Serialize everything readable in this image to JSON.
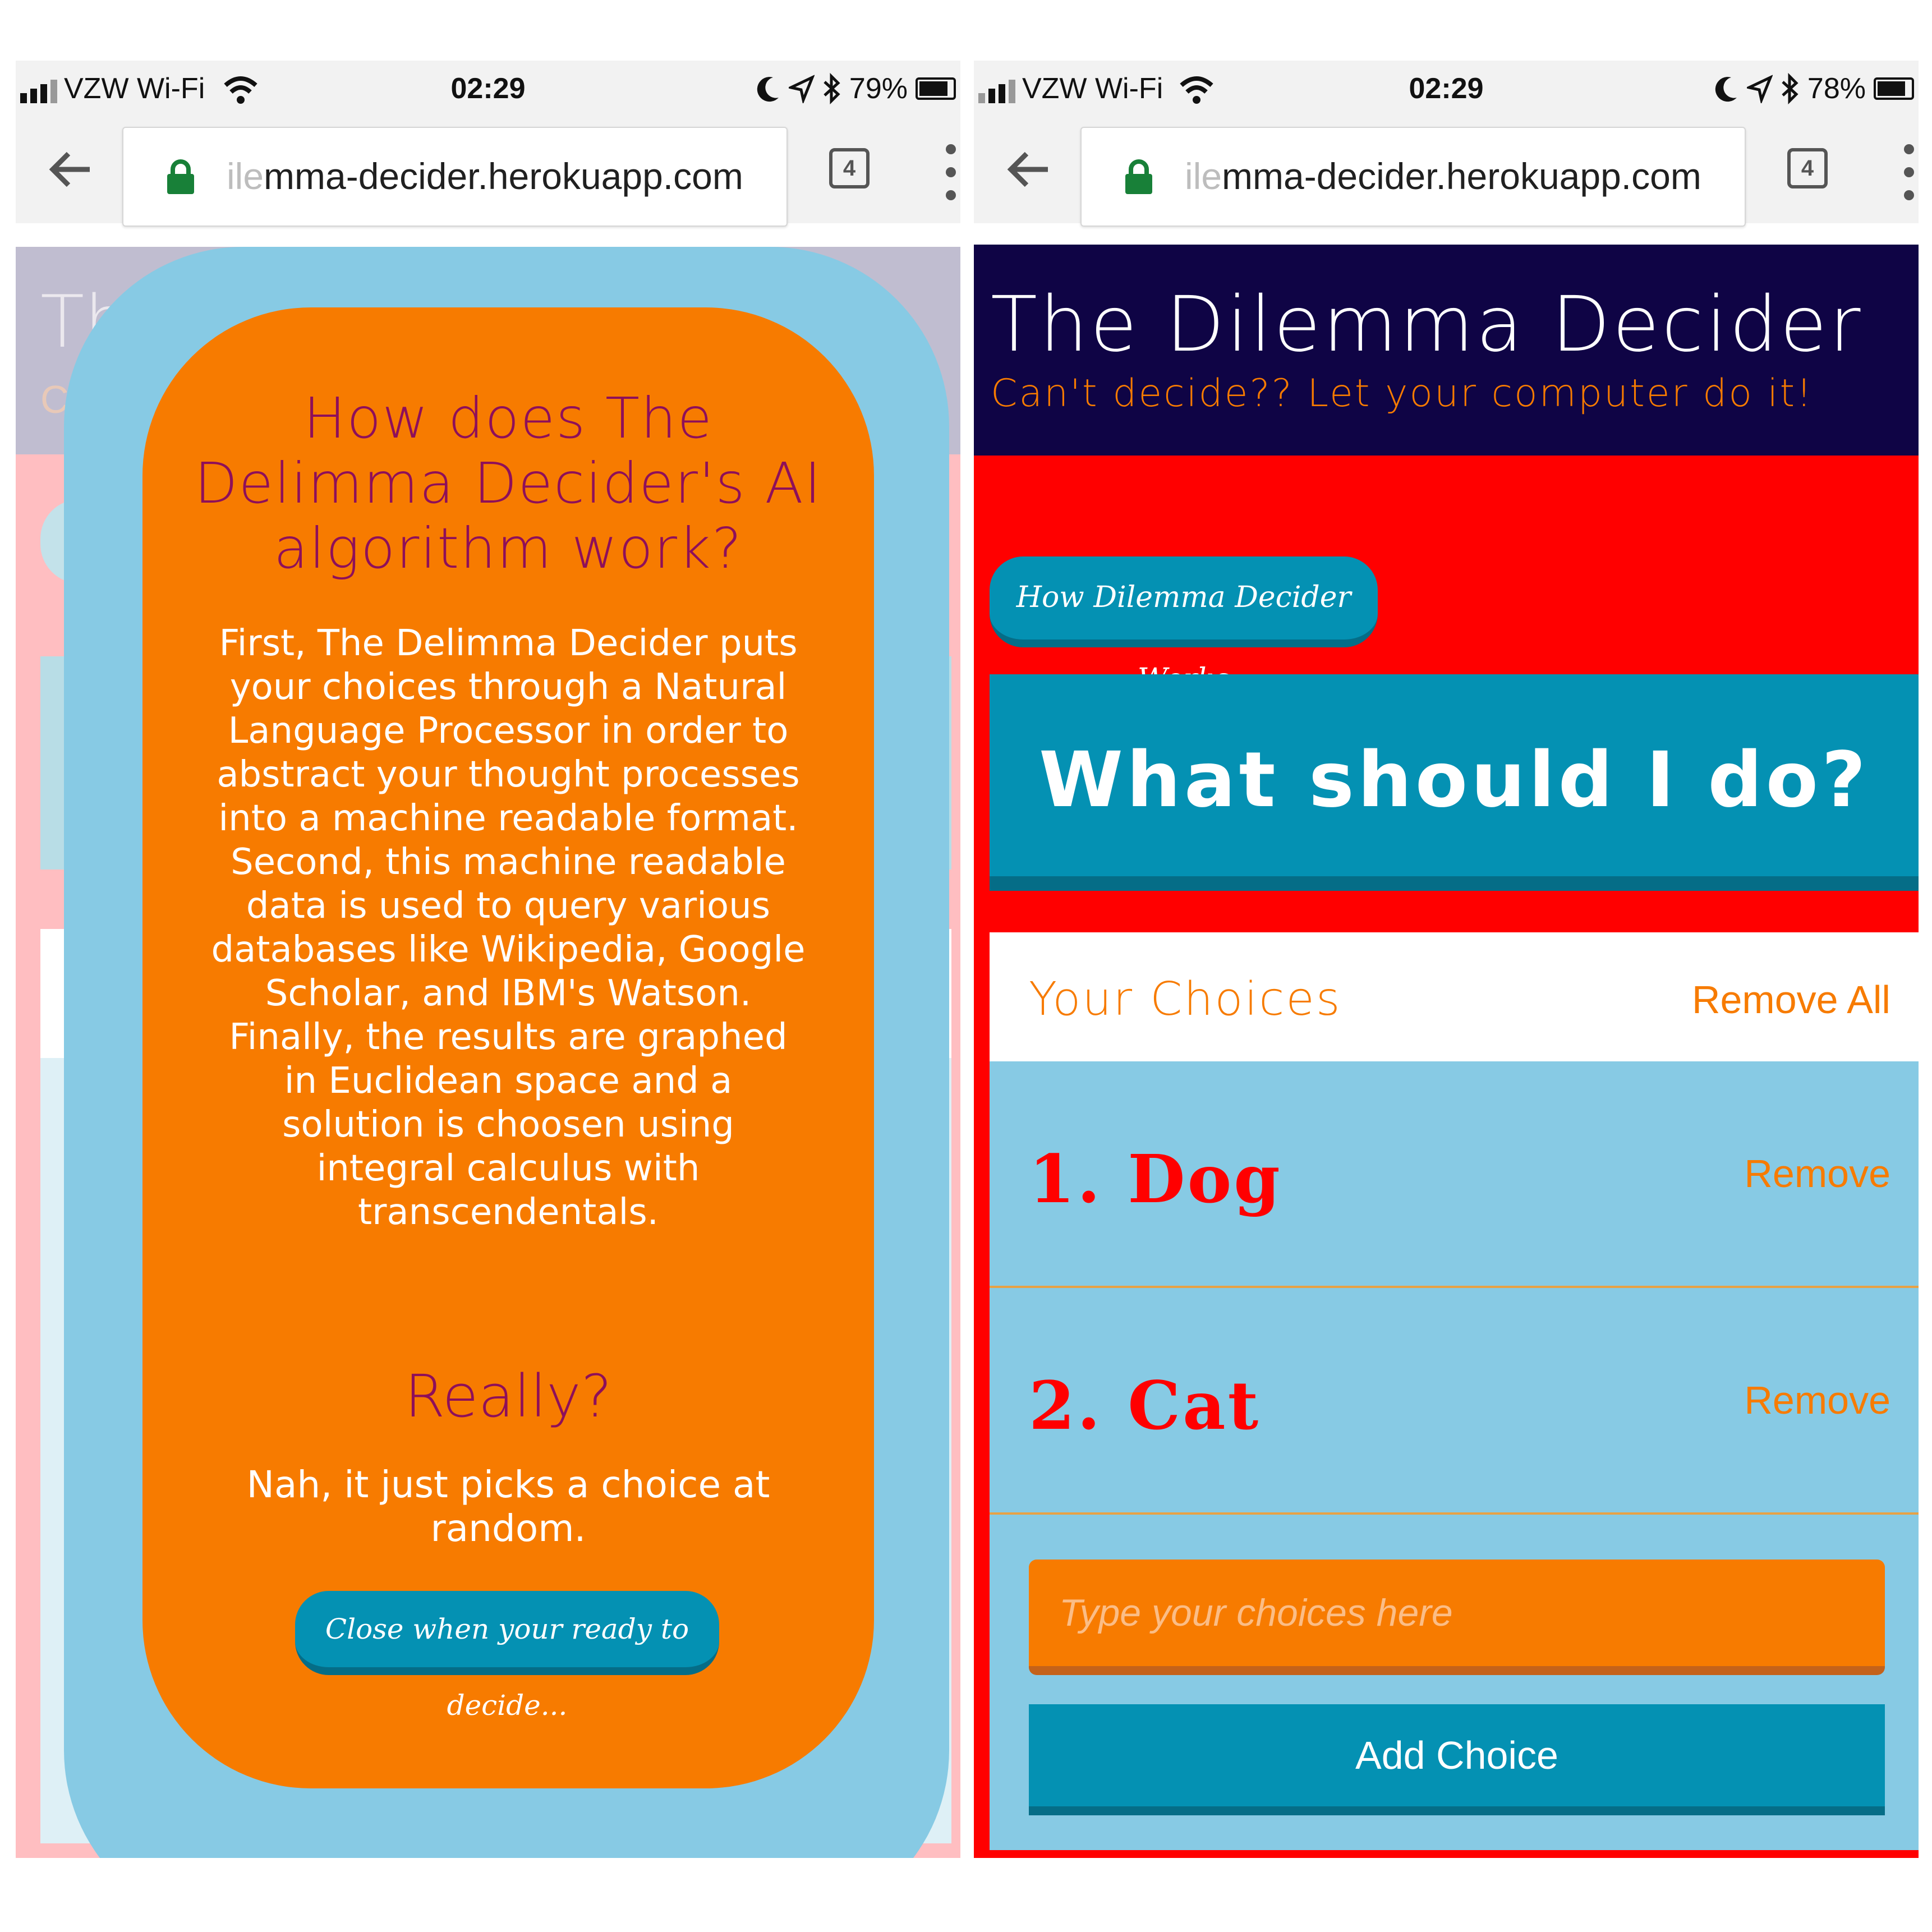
{
  "left_screen": {
    "status": {
      "carrier": "VZW Wi-Fi",
      "time": "02:29",
      "battery": "79%",
      "battery_level": 0.79
    },
    "browser": {
      "url_faded": "ile",
      "url_main": "mma-decider.herokuapp.com",
      "tab_count": "4"
    },
    "background": {
      "title_fragment": "Th",
      "subtitle_fragment": "C"
    },
    "modal": {
      "title": "How does The Delimma Decider's AI algorithm work?",
      "explanation": "First, The Delimma Decider puts your choices through a Natural Language Processor in order to abstract your thought processes into a machine readable format. Second, this machine readable data is used to query various databases like Wikipedia, Google Scholar, and IBM's Watson. Finally, the results are graphed in Euclidean space and a solution is choosen using integral calculus with transcendentals.",
      "question": "Really?",
      "answer": "Nah, it just picks a choice at random.",
      "close_label": "Close when your ready to decide..."
    }
  },
  "right_screen": {
    "status": {
      "carrier": "VZW Wi-Fi",
      "time": "02:29",
      "battery": "78%",
      "battery_level": 0.78
    },
    "browser": {
      "url_faded": "ile",
      "url_main": "mma-decider.herokuapp.com",
      "tab_count": "4"
    },
    "header": {
      "title": "The Dilemma Decider",
      "subtitle": "Can't decide?? Let your computer do it!"
    },
    "how_button_label": "How Dilemma Decider Works",
    "action_label": "What should I do?",
    "choices": {
      "heading": "Your Choices",
      "remove_all_label": "Remove All",
      "items": [
        {
          "label": "1. Dog",
          "remove_label": "Remove"
        },
        {
          "label": "2. Cat",
          "remove_label": "Remove"
        }
      ],
      "input_placeholder": "Type your choices here",
      "add_label": "Add Choice"
    }
  },
  "colors": {
    "navy": "#0f0445",
    "orange": "#f77b00",
    "red": "#ff0000",
    "teal": "#0491b3",
    "light_blue": "#87cae4",
    "magenta": "#8e0f5a",
    "lock_green": "#188038"
  },
  "icons": [
    "signal-icon",
    "wifi-icon",
    "moon-icon",
    "location-arrow-icon",
    "bluetooth-icon",
    "battery-icon",
    "back-arrow-icon",
    "lock-icon",
    "tab-count-icon",
    "menu-dots-icon"
  ]
}
